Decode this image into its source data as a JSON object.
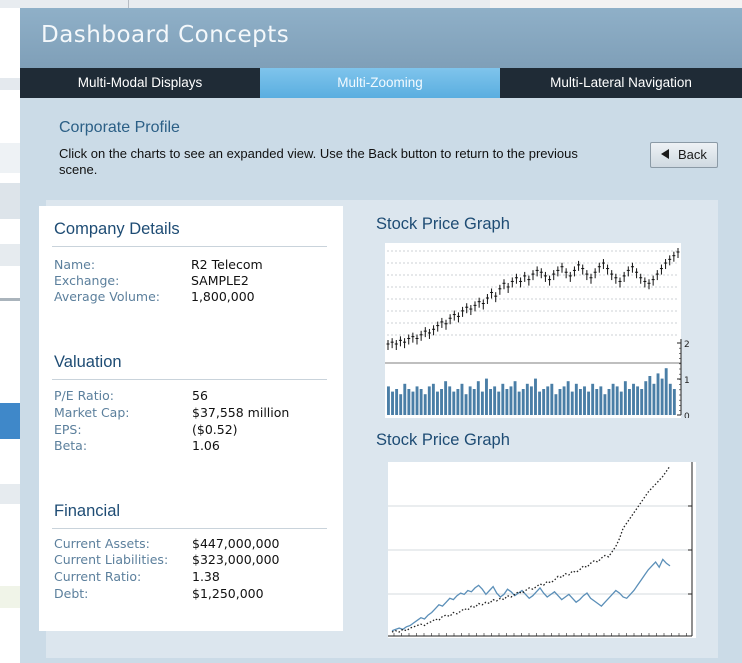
{
  "app": {
    "title": "Dashboard Concepts"
  },
  "nav": {
    "tabs": [
      {
        "label": "Multi-Modal Displays",
        "active": false
      },
      {
        "label": "Multi-Zooming",
        "active": true
      },
      {
        "label": "Multi-Lateral Navigation",
        "active": false
      }
    ]
  },
  "page": {
    "section_title": "Corporate Profile",
    "instructions": "Click on the charts to see an expanded view. Use the Back button to return to the previous scene.",
    "back_label": "Back"
  },
  "company": {
    "heading": "Company Details",
    "rows": [
      {
        "label": "Name:",
        "value": "R2 Telecom"
      },
      {
        "label": "Exchange:",
        "value": "SAMPLE2"
      },
      {
        "label": "Average Volume:",
        "value": "1,800,000"
      }
    ]
  },
  "valuation": {
    "heading": "Valuation",
    "rows": [
      {
        "label": "P/E Ratio:",
        "value": "56"
      },
      {
        "label": "Market Cap:",
        "value": "$37,558 million"
      },
      {
        "label": "EPS:",
        "value": "($0.52)"
      },
      {
        "label": "Beta:",
        "value": "1.06"
      }
    ]
  },
  "financial": {
    "heading": "Financial",
    "rows": [
      {
        "label": "Current Assets:",
        "value": "$447,000,000"
      },
      {
        "label": "Current Liabilities:",
        "value": "$323,000,000"
      },
      {
        "label": "Current Ratio:",
        "value": "1.38"
      },
      {
        "label": "Debt:",
        "value": "$1,250,000"
      }
    ]
  },
  "chart_data": [
    {
      "type": "line",
      "title": "Stock Price Graph",
      "subtype": "candlestick-with-volume",
      "price_series": [
        10,
        11,
        10,
        12,
        11,
        13,
        14,
        13,
        15,
        17,
        16,
        18,
        20,
        22,
        21,
        24,
        26,
        25,
        28,
        30,
        29,
        31,
        33,
        32,
        35,
        38,
        36,
        40,
        43,
        41,
        44,
        46,
        44,
        47,
        45,
        48,
        50,
        49,
        47,
        45,
        48,
        50,
        52,
        49,
        47,
        50,
        53,
        51,
        48,
        46,
        49,
        52,
        54,
        51,
        48,
        46,
        44,
        47,
        50,
        52,
        49,
        46,
        44,
        43,
        45,
        48,
        51,
        54,
        56,
        58,
        60
      ],
      "volume_axis_ticks": [
        "2",
        "1",
        "0"
      ],
      "volume_values": [
        1.1,
        0.9,
        1.0,
        0.8,
        1.2,
        1.0,
        0.9,
        1.1,
        1.0,
        0.8,
        1.1,
        1.2,
        0.9,
        1.0,
        1.3,
        1.1,
        0.9,
        1.0,
        1.2,
        0.8,
        1.1,
        1.0,
        1.3,
        0.9,
        1.4,
        1.0,
        1.1,
        0.9,
        1.2,
        1.0,
        1.1,
        1.3,
        0.9,
        1.0,
        1.2,
        1.1,
        1.4,
        0.9,
        1.0,
        1.1,
        1.2,
        0.8,
        1.0,
        1.1,
        1.3,
        0.9,
        1.2,
        1.0,
        1.1,
        0.9,
        1.2,
        1.0,
        1.1,
        0.8,
        1.0,
        1.2,
        1.1,
        0.9,
        1.3,
        1.0,
        1.2,
        1.1,
        1.0,
        1.3,
        1.5,
        1.2,
        1.6,
        1.4,
        1.8,
        1.2,
        1.0
      ]
    },
    {
      "type": "line",
      "title": "Stock Price Graph",
      "series": [
        {
          "style": "solid",
          "color": "#5b8fb8",
          "values": [
            5,
            6,
            7,
            6,
            8,
            9,
            11,
            13,
            15,
            14,
            17,
            19,
            22,
            25,
            24,
            27,
            30,
            29,
            32,
            34,
            33,
            36,
            35,
            38,
            40,
            37,
            33,
            36,
            39,
            34,
            31,
            33,
            37,
            35,
            32,
            34,
            36,
            33,
            30,
            32,
            35,
            38,
            34,
            31,
            33,
            35,
            32,
            29,
            31,
            33,
            30,
            27,
            29,
            32,
            34,
            30,
            28,
            26,
            24,
            27,
            30,
            33,
            36,
            34,
            31,
            30,
            33,
            36,
            40,
            44,
            48,
            52,
            55,
            58,
            54,
            60,
            57,
            55
          ]
        },
        {
          "style": "dotted",
          "color": "#222222",
          "values": [
            4,
            5,
            4,
            6,
            5,
            7,
            8,
            9,
            10,
            9,
            11,
            12,
            14,
            13,
            16,
            17,
            16,
            19,
            18,
            20,
            22,
            21,
            24,
            23,
            26,
            25,
            27,
            26,
            29,
            28,
            30,
            29,
            32,
            31,
            33,
            35,
            34,
            36,
            38,
            37,
            39,
            41,
            40,
            43,
            42,
            44,
            47,
            46,
            49,
            48,
            51,
            50,
            52,
            55,
            54,
            57,
            59,
            58,
            61,
            63,
            62,
            66,
            70,
            76,
            84,
            88,
            92,
            96,
            100,
            104,
            108,
            112,
            115,
            118,
            121,
            124,
            128,
            132
          ]
        }
      ]
    }
  ],
  "colors": {
    "accent": "#5aaee0",
    "title_bar": "#8aacc4",
    "nav": "#1f2b36",
    "heading": "#1e4c74",
    "label": "#5b7f9c"
  }
}
